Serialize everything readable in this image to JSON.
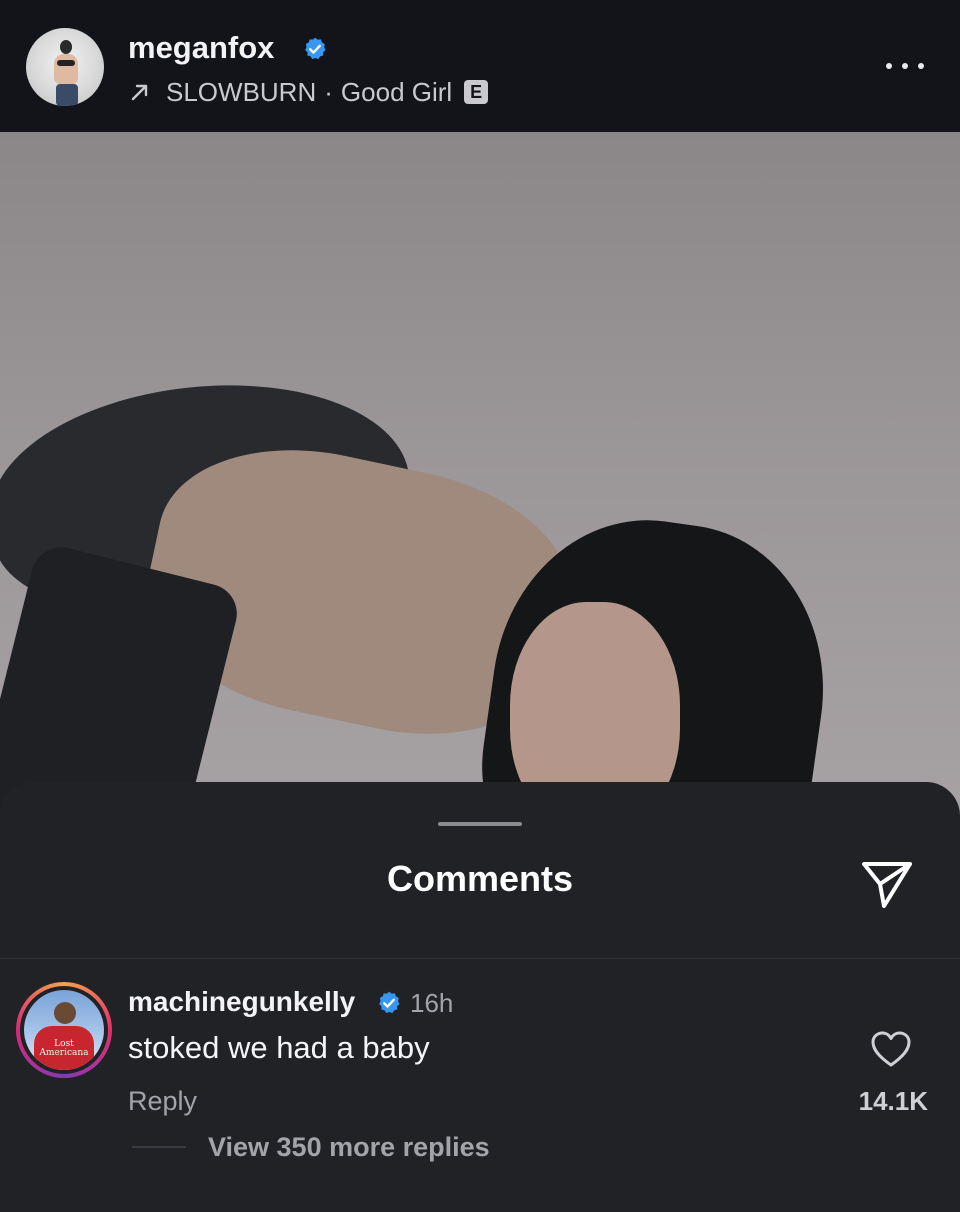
{
  "header": {
    "username": "meganfox",
    "track_artist": "SLOWBURN",
    "separator": "·",
    "track_title": "Good Girl",
    "explicit_badge": "E",
    "icons": [
      "verified-badge-icon",
      "music-arrow-icon",
      "more-options-icon"
    ]
  },
  "sheet": {
    "title": "Comments",
    "icons": [
      "send-icon"
    ]
  },
  "comment": {
    "username": "machinegunkelly",
    "time": "16h",
    "text": "stoked we had a baby",
    "reply_label": "Reply",
    "likes": "14.1K",
    "view_replies": "View 350 more replies",
    "avatar_text": "Lost Americana",
    "icons": [
      "verified-badge-icon",
      "heart-icon"
    ]
  },
  "colors": {
    "verified": "#3897f0",
    "sheet_bg": "#212226",
    "header_bg": "#131419"
  }
}
